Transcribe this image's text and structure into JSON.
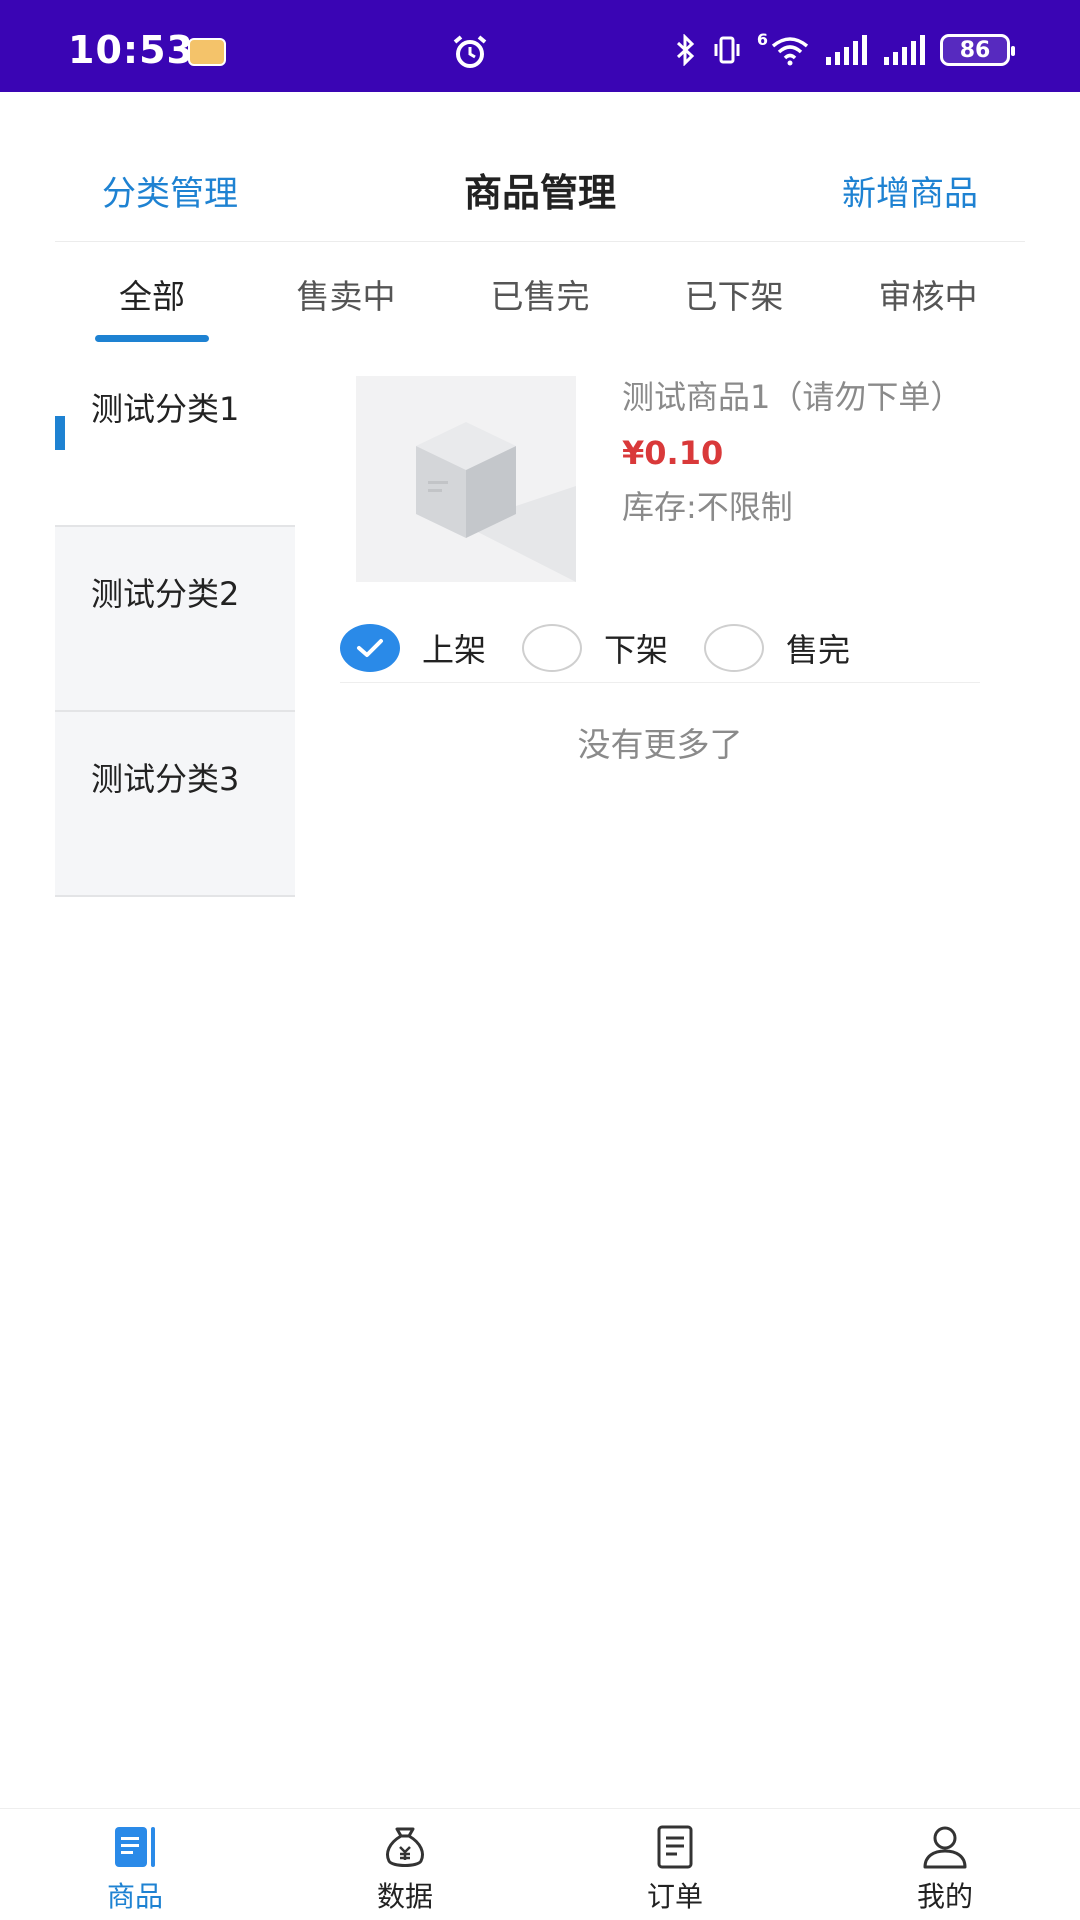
{
  "status_bar": {
    "time": "10:53",
    "network_badge": "6",
    "battery": "86"
  },
  "header": {
    "left_action": "分类管理",
    "title": "商品管理",
    "right_action": "新增商品"
  },
  "tabs": [
    {
      "label": "全部",
      "active": true
    },
    {
      "label": "售卖中",
      "active": false
    },
    {
      "label": "已售完",
      "active": false
    },
    {
      "label": "已下架",
      "active": false
    },
    {
      "label": "审核中",
      "active": false
    }
  ],
  "categories": [
    {
      "label": "测试分类1",
      "active": true
    },
    {
      "label": "测试分类2",
      "active": false
    },
    {
      "label": "测试分类3",
      "active": false
    }
  ],
  "product": {
    "name": "测试商品1（请勿下单）",
    "price": "¥0.10",
    "stock": "库存:不限制",
    "status_options": [
      {
        "label": "上架",
        "checked": true
      },
      {
        "label": "下架",
        "checked": false
      },
      {
        "label": "售完",
        "checked": false
      }
    ]
  },
  "list_end_text": "没有更多了",
  "bottom_nav": [
    {
      "label": "商品",
      "icon": "goods-icon",
      "active": true
    },
    {
      "label": "数据",
      "icon": "money-bag-icon",
      "active": false
    },
    {
      "label": "订单",
      "icon": "order-icon",
      "active": false
    },
    {
      "label": "我的",
      "icon": "profile-icon",
      "active": false
    }
  ],
  "colors": {
    "status_bar": "#3a05b4",
    "accent": "#1e82d2",
    "price": "#d9393a",
    "checked_radio": "#2a8ae8"
  }
}
